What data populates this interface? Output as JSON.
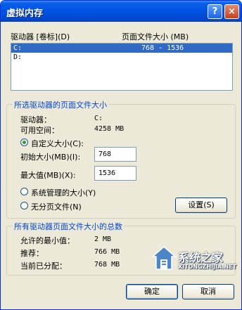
{
  "window": {
    "title": "虚拟内存"
  },
  "titlebar": {
    "help_label": "?",
    "close_label": "×"
  },
  "drives": {
    "col_drive": "驱动器 [卷标](D)",
    "col_paging": "页面文件大小 (MB)",
    "items": [
      {
        "drive": "C:",
        "paging": "768 - 1536",
        "selected": true
      },
      {
        "drive": "D:",
        "paging": "",
        "selected": false
      }
    ]
  },
  "selected_group": {
    "title": "所选驱动器的页面文件大小",
    "drive_label": "驱动器：",
    "drive_value": "C:",
    "space_label": "可用空间：",
    "space_value": "4258 MB",
    "custom_label": "自定义大小(C):",
    "initial_label": "初始大小(MB)(I):",
    "initial_value": "768",
    "max_label": "最大值(MB)(X):",
    "max_value": "1536",
    "system_label": "系统管理的大小(Y)",
    "nofile_label": "无分页文件(N)",
    "set_button": "设置(S)",
    "selected_option": "custom"
  },
  "total_group": {
    "title": "所有驱动器页面文件大小的总数",
    "min_label": "允许的最小值：",
    "min_value": "2 MB",
    "rec_label": "推荐：",
    "rec_value": "766 MB",
    "cur_label": "当前已分配：",
    "cur_value": "768 MB"
  },
  "buttons": {
    "ok": "确定",
    "cancel": "取消"
  },
  "watermark": {
    "title": "系统之家",
    "url": "XITONGZHIJIA.NET"
  }
}
